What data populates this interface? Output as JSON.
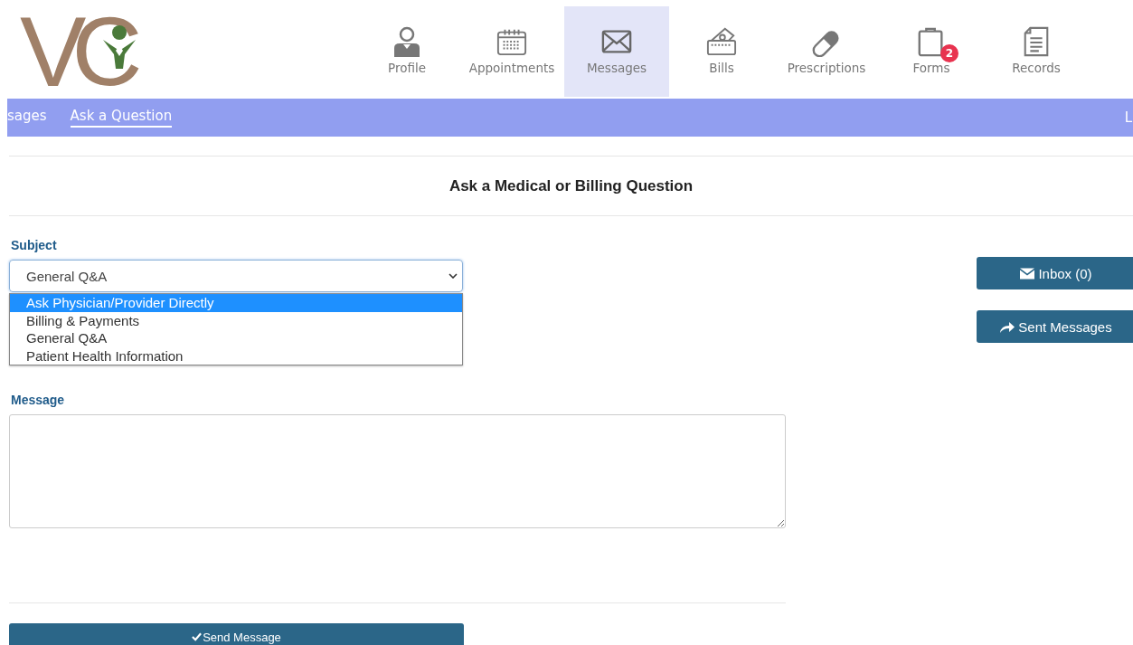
{
  "logo": {
    "first": "V",
    "second": "C"
  },
  "nav": [
    {
      "label": "Profile",
      "kind": "person",
      "selected": false
    },
    {
      "label": "Appointments",
      "kind": "calendar",
      "selected": false
    },
    {
      "label": "Messages",
      "kind": "envelope",
      "selected": true
    },
    {
      "label": "Bills",
      "kind": "wallet",
      "selected": false
    },
    {
      "label": "Prescriptions",
      "kind": "pill",
      "selected": false
    },
    {
      "label": "Forms",
      "kind": "clipboard",
      "selected": false,
      "badge": "2"
    },
    {
      "label": "Records",
      "kind": "document",
      "selected": false
    }
  ],
  "subnav": [
    {
      "label": "sages",
      "selected": false
    },
    {
      "label": "Ask a Question",
      "selected": true
    }
  ],
  "subnav_edge": "L",
  "title": "Ask a Medical or Billing Question",
  "subject": {
    "label": "Subject",
    "value": "General Q&A",
    "expanded": true,
    "options": [
      {
        "label": "Ask Physician/Provider Directly",
        "highlighted": true
      },
      {
        "label": "Billing & Payments",
        "highlighted": false
      },
      {
        "label": "General Q&A",
        "highlighted": false
      },
      {
        "label": "Patient Health Information",
        "highlighted": false
      }
    ]
  },
  "message": {
    "label": "Message"
  },
  "side_buttons": [
    {
      "label": "Inbox (0)",
      "kind": "envelope"
    },
    {
      "label": "Sent Messages",
      "kind": "share"
    }
  ],
  "send_button": "Send Message"
}
